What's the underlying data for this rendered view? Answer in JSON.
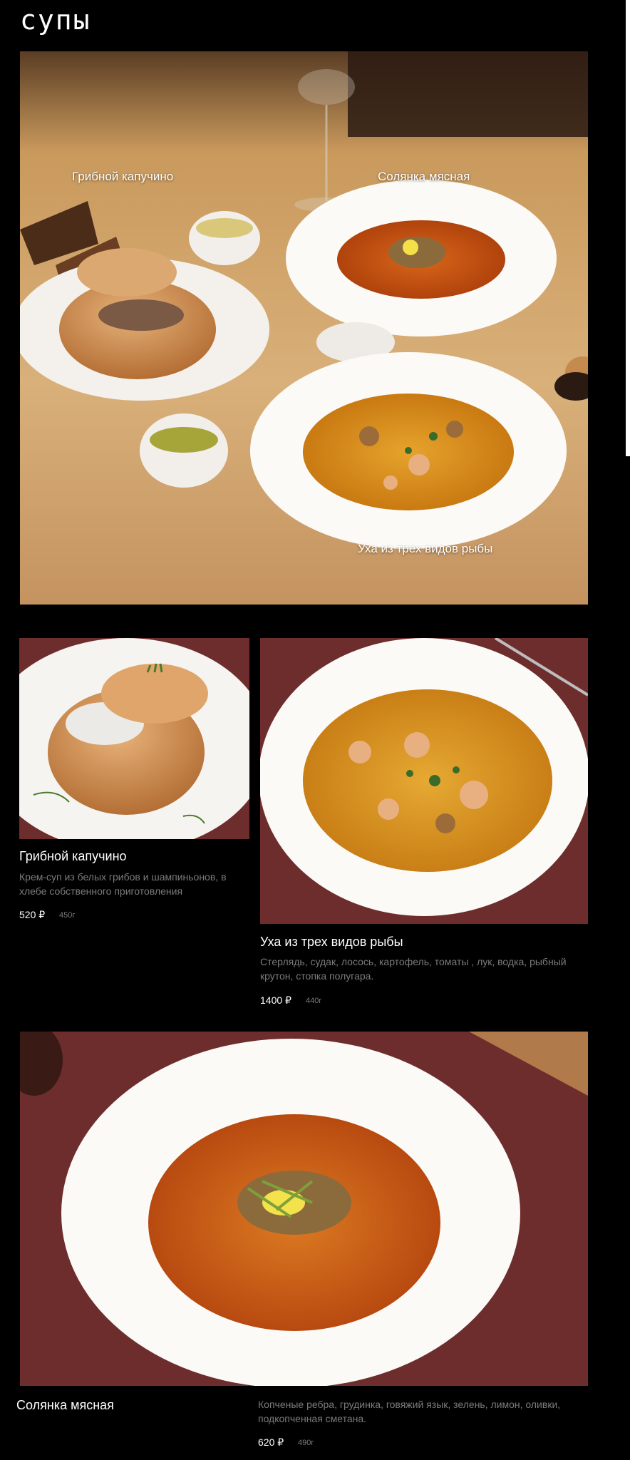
{
  "page": {
    "title": "супы"
  },
  "hero": {
    "labels": {
      "mushroom": "Грибной капучино",
      "solyanka": "Солянка мясная",
      "ukha": "Уха из трех видов рыбы"
    }
  },
  "dishes": [
    {
      "name": "Грибной капучино",
      "description": "Крем-суп из белых грибов и шампиньонов, в хлебе собственного приготовления",
      "price": "520 ₽",
      "weight": "450г"
    },
    {
      "name": "Уха из трех видов рыбы",
      "description": "Стерлядь, судак, лосось, картофель, томаты , лук, водка, рыбный крутон, стопка полугара.",
      "price": "1400 ₽",
      "weight": "440г"
    },
    {
      "name": "Солянка мясная",
      "description": "Копченые ребра, грудинка, говяжий язык, зелень, лимон, оливки, подкопченная сметана.",
      "price": "620 ₽",
      "weight": "490г"
    }
  ],
  "colors": {
    "background": "#000000",
    "table_wood": "#c79b63",
    "leather_mat": "#6d2d2d",
    "soup_orange": "#e08a1e",
    "muted_text": "#7b7b7b"
  }
}
